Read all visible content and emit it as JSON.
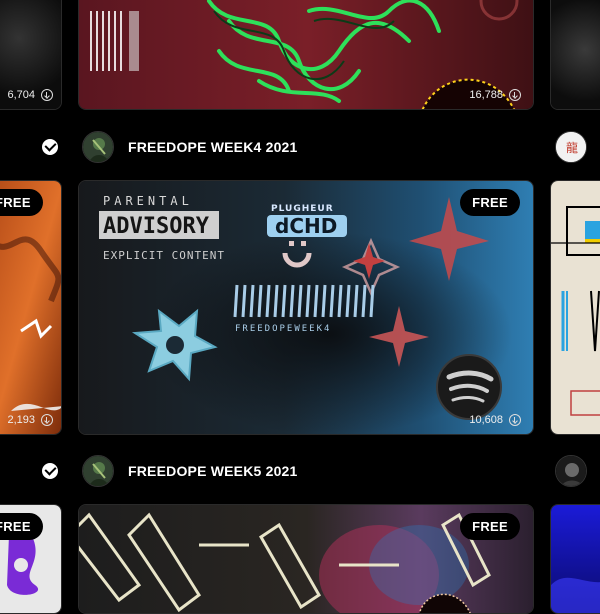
{
  "top_row": {
    "left_downloads": "6,704",
    "main_downloads": "16,788"
  },
  "rows": [
    {
      "title": "FREEDOPE WEEK4 2021",
      "badge": "FREE",
      "left_badge": "FREE",
      "left_downloads": "2,193",
      "main_downloads": "10,608",
      "art_text": {
        "parental": "PARENTAL",
        "advisory": "ADVISORY",
        "explicit": "EXPLICIT CONTENT",
        "brand": "PLUGHEUR",
        "brand_big": "dCHD",
        "barcode_text": "FREEDOPEWEEK4"
      }
    },
    {
      "title": "FREEDOPE WEEK5 2021",
      "badge": "FREE",
      "left_badge": "FREE"
    }
  ],
  "colors": {
    "background": "#000000",
    "badge_bg": "#000000",
    "text": "#ffffff"
  },
  "icons": [
    "download-icon",
    "verified-icon",
    "spotify-icon",
    "avatar"
  ]
}
